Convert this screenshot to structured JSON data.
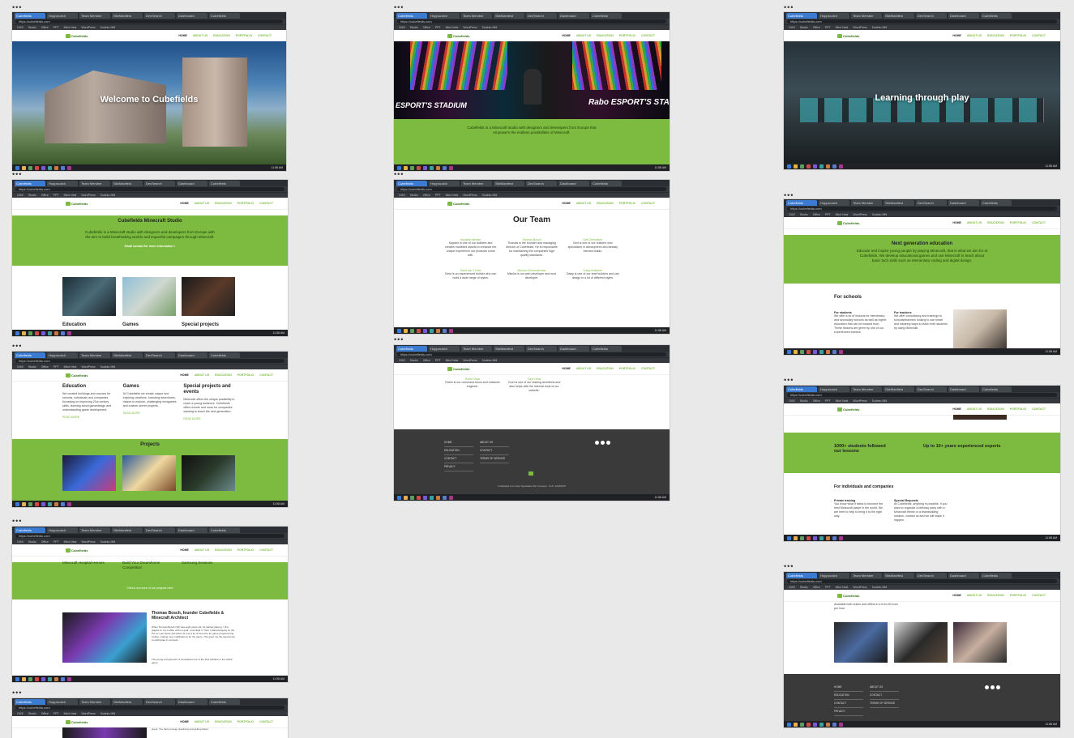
{
  "browser": {
    "tabs": [
      "Cubefields",
      "Hoppscotch",
      "Team Member",
      "SiteManifest",
      "DevSearch",
      "Dashboard",
      "Cubefields"
    ],
    "url": "https://cubefields.com",
    "bookmarks": [
      "CMS",
      "Studio",
      "Office",
      "PPT",
      "Mind Nest",
      "WordPress",
      "Sudeku MM"
    ]
  },
  "site": {
    "logo": "Cubefields",
    "nav": [
      "HOME",
      "ABOUT US",
      "EDUCATION",
      "PORTFOLIO",
      "CONTACT"
    ]
  },
  "taskbar": {
    "time": "11:58 AM"
  },
  "screens": {
    "s1": {
      "hero_title": "Welcome to Cubefields"
    },
    "s2": {
      "banner_left": "ESPORT'S STADIUM",
      "banner_right": "Rabo ESPORT'S STA",
      "tagline": "Cubefields is a Minecraft studio with designers and developers from Europe that empowers the endless possibilities of Minecraft."
    },
    "s3": {
      "hero_title": "Learning through play"
    },
    "s4": {
      "title": "Cubefields Minecraft Studio",
      "text": "Cubefields is a Minecraft studio with designers and developers from Europe with the aim to build breathtaking worlds and impactful campaigns through Minecraft.",
      "cta": "Email contact for more information >",
      "cards": [
        "Education",
        "Games",
        "Special projects"
      ]
    },
    "s5": {
      "title": "Our Team",
      "members": [
        {
          "name": "Kaydean Beelen",
          "text": "Kayden is one of our builders and creates modelled assets to enhance the unique experience our products come with."
        },
        {
          "name": "Thomas Bosch",
          "text": "Thomas is the founder and managing director of Cubefields. He is responsible for maintaining the companies high quality standards."
        },
        {
          "name": "Gert Zeewieker",
          "text": "Gert is one of our builders who specializes in atmospheric and fantasy themed builds."
        },
        {
          "name": "Danil van 't Hofe",
          "text": "Dewi is an experienced builder who can build a wide range of styles."
        },
        {
          "name": "Mischa Gilmunderman",
          "text": "Mischa is our web developer and mod developer."
        },
        {
          "name": "Daisy Bosteker",
          "text": "Daisy is one of our lead builders and can design in a lot of different styles."
        }
      ]
    },
    "s6": {
      "members": [
        {
          "name": "Robin Vlaar",
          "text": "Robin is our command block and redstone engineer."
        },
        {
          "name": "Youri Heck",
          "text": "Youri is one of our leading architects and also helps with the internal tools of our website."
        }
      ],
      "footer_col1": [
        "HOME",
        "EDUCATION",
        "CONTACT",
        "PRIVACY"
      ],
      "footer_col2": [
        "ABOUT US",
        "CONTACT",
        "TERMS OF SERVICE"
      ],
      "footer_copyright": "Cubefields is a Cube Specialists BV company · KvK: 12345678"
    },
    "s7": {
      "title": "Next generation education",
      "text": "Educate and inspire young people by playing Minecraft, that is what we aim for at Cubefields. We develop educational games and use Minecraft to teach about basic tech skills such as elementary coding and digital design.",
      "schools": "For schools",
      "col1_title": "For students",
      "col2_title": "For teachers",
      "col1_text": "We offer a lot of lessons for elementary and secondary schools as well as higher education that can be booked from. These lessons are given by one of our experienced trainers.",
      "col2_text": "We offer consultancy and trainings to schools/teachers looking to use smart and inspiring ways to teach their students by using Minecraft."
    },
    "s8": {
      "cols": [
        "Education",
        "Games",
        "Special projects and events"
      ],
      "texts": [
        "We created buildings and courses for schools, individuals and companies focussing on improving 21st century skills, learning about gamedesign and understanding game development.",
        "At Cubefields we create unique and inspiring creations. Including adventures, mazes to explore, challenging minigames and custom server projects.",
        "Minecraft offers the unique possibility to reach a young audience. Cubefields offers events and more for companies wanting to reach the next generation."
      ],
      "read_more": "READ MORE",
      "projects": "Projects"
    },
    "s9": {
      "stat1": "1000+ students followed our lessons",
      "stat2": "Up to 10+ years experienced experts",
      "title": "For individuals and companies",
      "col1_title": "Private training",
      "col2_title": "Special Requests",
      "col1_text": "You know what it takes to become the best Minecraft player in the world. We are here to help to bring it to the right way.",
      "col2_text": "At Cubefields, anything is possible. If you want to organize a birthday party with a Minecraft theme or a teambuilding session, contact us and we will make it happen."
    },
    "s10": {
      "items": [
        "Minecraft Hospital Heroes",
        "Build Your Dreamhome Competition",
        "Samsung Sessions"
      ],
      "check_out": "Check out more of our projects here",
      "founder_title": "Thomas Bosch, founder Cubefields & Minecraft Architect",
      "founder_text": "When Thomas Bosch (18) was eight years old, he started playing. I first played on my mobile, with no goal. I just liked it. Then I started playing on the PC on I got better and better at it as a lot of free time for game programming, coding, making new modifications for the game. This gave me the opportunity to participate in contests.",
      "founder_text2": "The young entrepreneur is considered one of the best builders in the whole game."
    },
    "s11": {
      "text": "Available both online and offline in a from 50 euro per hour"
    },
    "s12": {
      "text": "spent. You have to keep practicing and getting better."
    }
  }
}
